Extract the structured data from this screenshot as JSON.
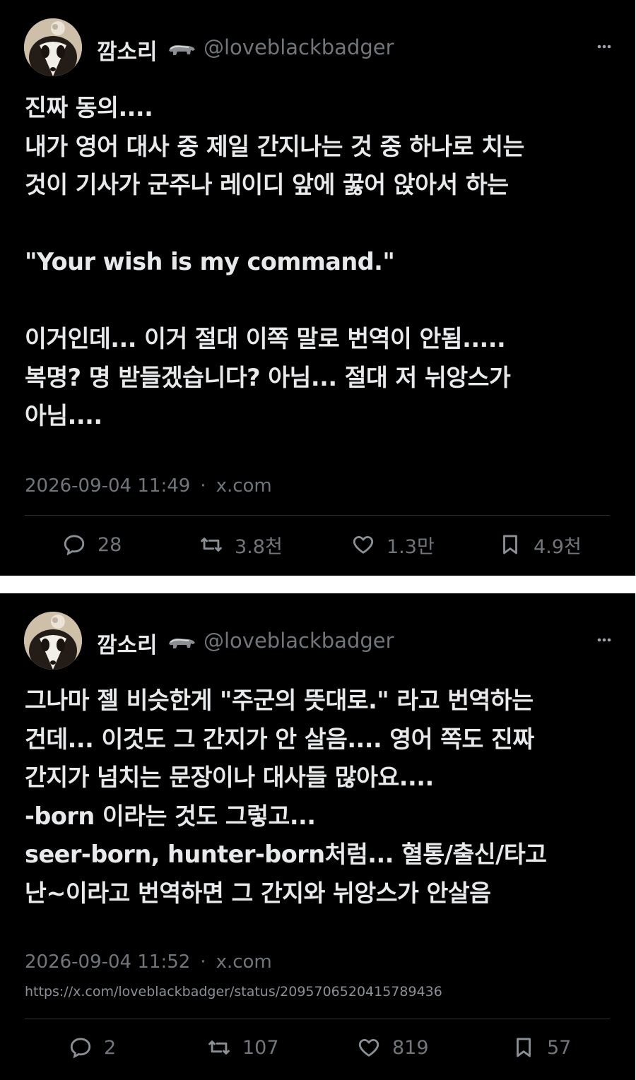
{
  "tweets": [
    {
      "author": {
        "name": "깜소리",
        "emoji_icon": "badger-icon",
        "handle": "@loveblackbadger"
      },
      "text": "진짜 동의....\n내가 영어 대사 중 제일 간지나는 것 중 하나로 치는\n것이 기사가 군주나 레이디 앞에 꿇어 앉아서 하는\n\n\"Your wish is my command.\"\n\n이거인데... 이거 절대 이쪽 말로 번역이 안됨.....\n복명? 명 받들겠습니다? 아님... 절대 저 뉘앙스가\n아님....",
      "timestamp": "2026-09-04 11:49",
      "source": "x.com",
      "stats": {
        "replies": "28",
        "retweets": "3.8천",
        "likes": "1.3만",
        "bookmarks": "4.9천"
      }
    },
    {
      "author": {
        "name": "깜소리",
        "emoji_icon": "badger-icon",
        "handle": "@loveblackbadger"
      },
      "text": "그나마 젤 비슷한게 \"주군의 뜻대로.\" 라고 번역하는\n건데... 이것도 그 간지가 안 살음.... 영어 쪽도 진짜\n간지가 넘치는 문장이나 대사들 많아요....\n-born 이라는 것도 그렇고...\nseer-born, hunter-born처럼... 혈통/출신/타고\n난~이라고 번역하면 그 간지와 뉘앙스가 안살음",
      "timestamp": "2026-09-04 11:52",
      "source": "x.com",
      "url": "https://x.com/loveblackbadger/status/2095706520415789436",
      "stats": {
        "replies": "2",
        "retweets": "107",
        "likes": "819",
        "bookmarks": "57"
      }
    }
  ],
  "colors": {
    "background": "#000000",
    "text": "#e7e9ea",
    "muted": "#71767b",
    "divider": "#2f3336"
  }
}
